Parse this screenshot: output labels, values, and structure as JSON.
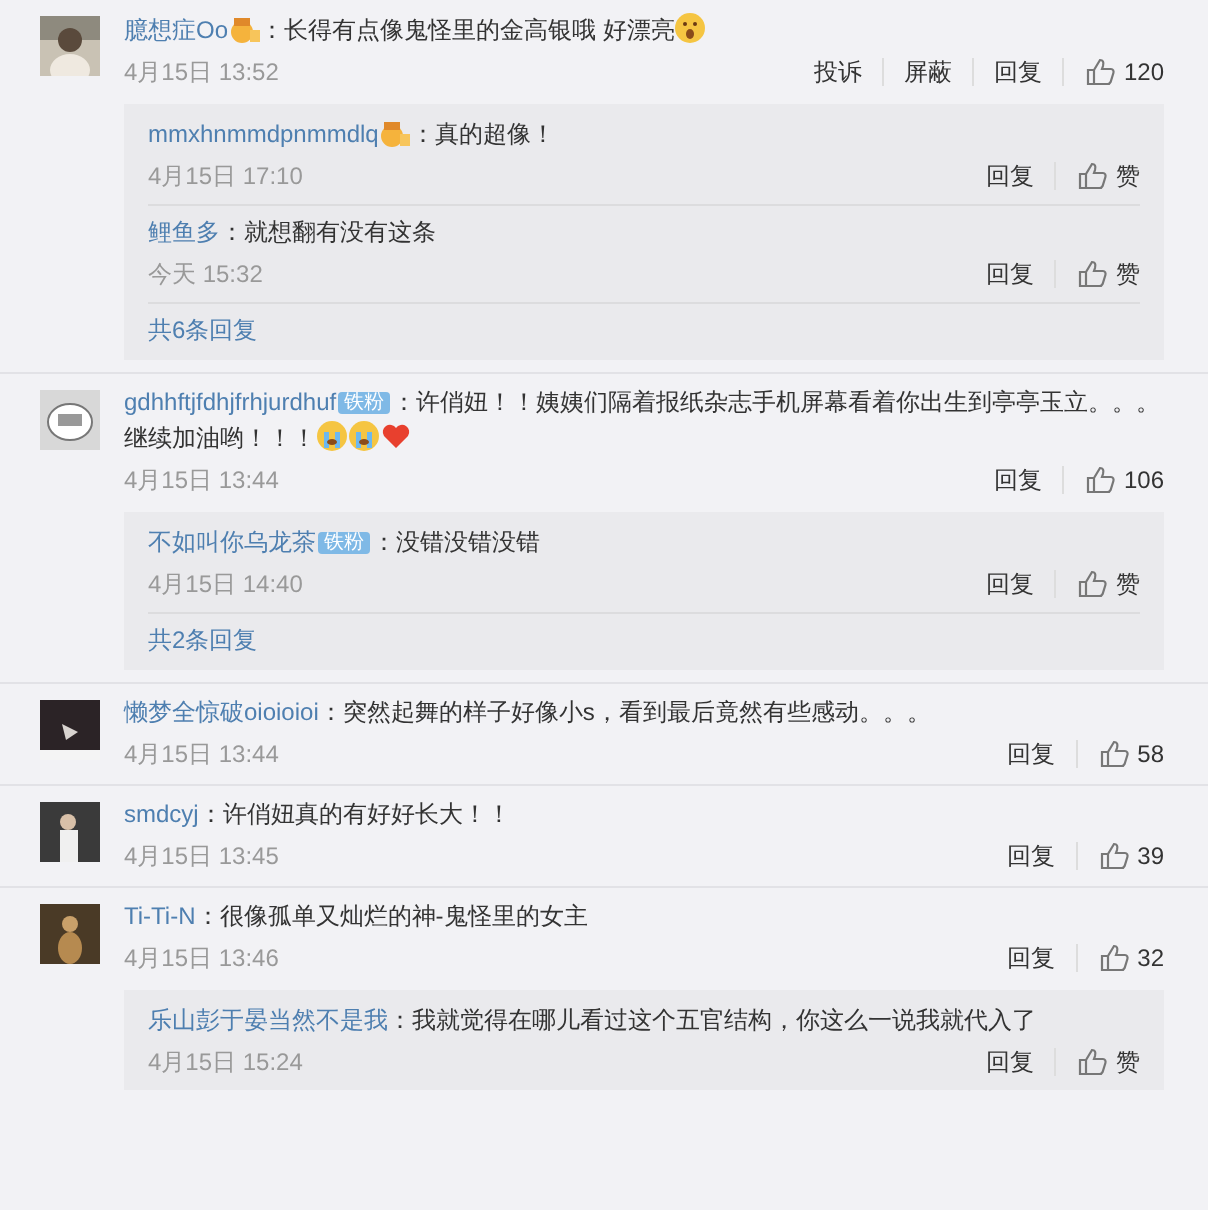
{
  "comments": [
    {
      "user": "臆想症Oo",
      "badge": {
        "kind": "medal"
      },
      "text": "：长得有点像鬼怪里的金高银哦 好漂亮",
      "emojis": [
        {
          "kind": "shock"
        }
      ],
      "time": "4月15日 13:52",
      "actions": [
        "投诉",
        "屏蔽",
        "回复"
      ],
      "likes": "120",
      "avatar": {
        "kind": "picture"
      },
      "replies": [
        {
          "user": "mmxhnmmdpnmmdlq",
          "badge": {
            "kind": "medal"
          },
          "text": "：真的超像！",
          "time": "4月15日 17:10",
          "reply": "回复",
          "like": "赞"
        },
        {
          "user": "鲤鱼多",
          "text": "：就想翻有没有这条",
          "time": "今天 15:32",
          "reply": "回复",
          "like": "赞"
        }
      ],
      "more": "共6条回复"
    },
    {
      "user": "gdhhftjfdhjfrhjurdhuf",
      "badge": {
        "kind": "fan",
        "label": "铁粉"
      },
      "text": "：许俏妞！！姨姨们隔着报纸杂志手机屏幕看着你出生到亭亭玉立。。。",
      "text_2": "继续加油哟！！！",
      "emojis": [
        {
          "kind": "cry"
        },
        {
          "kind": "cry"
        },
        {
          "kind": "heart"
        }
      ],
      "time": "4月15日 13:44",
      "actions": [
        "回复"
      ],
      "likes": "106",
      "avatar": {
        "kind": "picture"
      },
      "replies": [
        {
          "user": "不如叫你乌龙茶",
          "badge": {
            "kind": "fan",
            "label": "铁粉"
          },
          "text": "：没错没错没错",
          "time": "4月15日 14:40",
          "reply": "回复",
          "like": "赞"
        }
      ],
      "more": "共2条回复"
    },
    {
      "user": "懒梦全惊破oioioioi",
      "text": "：突然起舞的样子好像小s，看到最后竟然有些感动。。。",
      "time": "4月15日 13:44",
      "actions": [
        "回复"
      ],
      "likes": "58",
      "avatar": {
        "kind": "picture"
      }
    },
    {
      "user": "smdcyj",
      "text": "：许俏妞真的有好好长大！！",
      "time": "4月15日 13:45",
      "actions": [
        "回复"
      ],
      "likes": "39",
      "avatar": {
        "kind": "picture"
      }
    },
    {
      "user": "Ti-Ti-N",
      "text": "：很像孤单又灿烂的神-鬼怪里的女主",
      "time": "4月15日 13:46",
      "actions": [
        "回复"
      ],
      "likes": "32",
      "avatar": {
        "kind": "picture"
      },
      "replies": [
        {
          "user": "乐山彭于晏当然不是我",
          "text": "：我就觉得在哪儿看过这个五官结构，你这么一说我就代入了",
          "time": "4月15日 15:24",
          "reply": "回复",
          "like": "赞"
        }
      ]
    }
  ]
}
